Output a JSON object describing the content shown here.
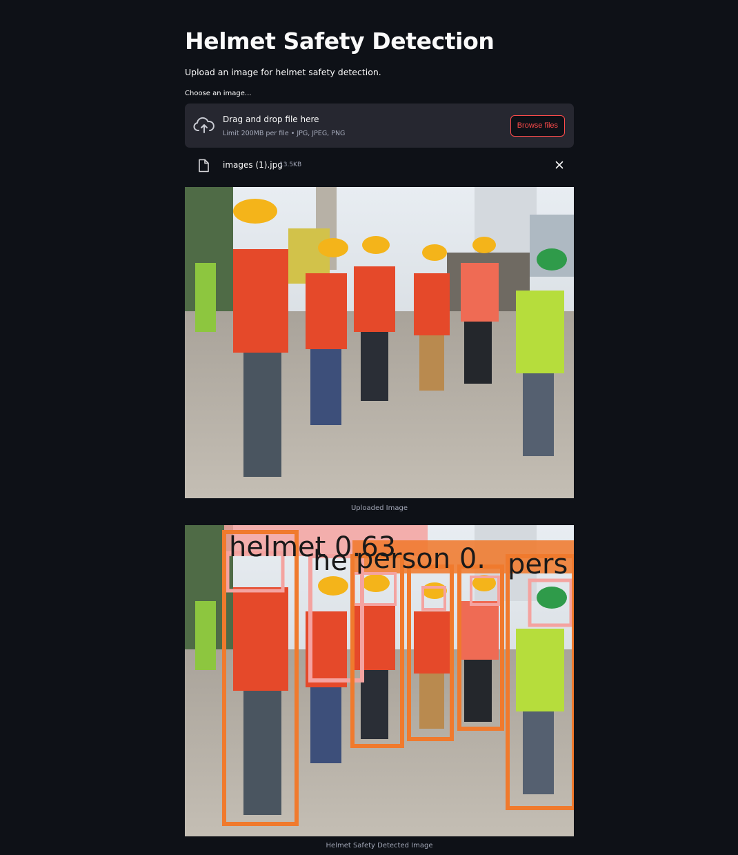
{
  "page": {
    "title": "Helmet Safety Detection",
    "subtitle": "Upload an image for helmet safety detection."
  },
  "uploader": {
    "label": "Choose an image...",
    "drop_text": "Drag and drop file here",
    "limit_text": "Limit 200MB per file • JPG, JPEG, PNG",
    "browse_label": "Browse files",
    "icon": "cloud-upload-icon"
  },
  "uploaded_file": {
    "name": "images (1).jpg",
    "size": "13.5KB",
    "icon": "file-icon",
    "remove_icon": "close-icon"
  },
  "images": {
    "uploaded_caption": "Uploaded Image",
    "detected_caption": "Helmet Safety Detected Image"
  },
  "detections": {
    "labels": [
      "helmet 0.63",
      "he",
      "person 0.",
      "pers"
    ]
  },
  "colors": {
    "background": "#0e1117",
    "surface": "#262730",
    "accent": "#ff4b4b",
    "text": "#fafafa",
    "muted": "#a3a8b8",
    "box_person": "#f07a2d",
    "box_helmet": "#f4a3a0"
  }
}
